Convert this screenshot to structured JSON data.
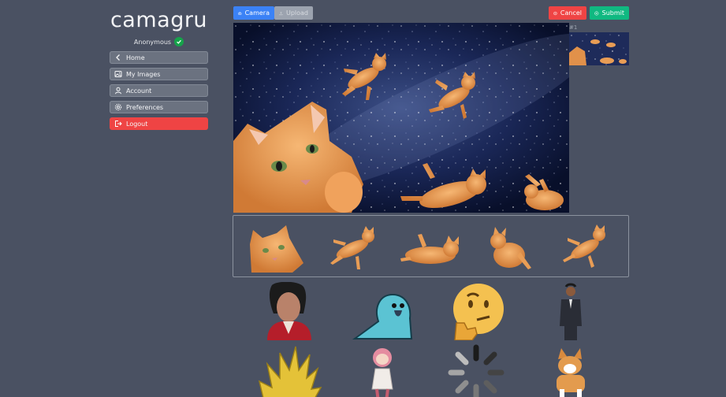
{
  "sidebar": {
    "brand": "camagru",
    "username": "Anonymous",
    "items": [
      {
        "label": "Home",
        "icon": "chevron-left-icon"
      },
      {
        "label": "My Images",
        "icon": "image-icon"
      },
      {
        "label": "Account",
        "icon": "user-icon"
      },
      {
        "label": "Preferences",
        "icon": "gear-icon"
      },
      {
        "label": "Logout",
        "icon": "logout-icon"
      }
    ]
  },
  "toolbar": {
    "camera_label": "Camera",
    "upload_label": "Upload",
    "cancel_label": "Cancel",
    "submit_label": "Submit"
  },
  "thumbnails": [
    {
      "label": "#1"
    }
  ],
  "colors": {
    "background": "#4a5162",
    "primary": "#3b82f6",
    "danger": "#ef4444",
    "success": "#10b981",
    "disabled": "#9ca3af"
  },
  "stickers_selected": [
    "cat-face",
    "flying-cat",
    "lying-cat",
    "sitting-cat",
    "flying-cat-2"
  ],
  "gallery": [
    "singer-portrait",
    "blue-parrot",
    "thinking-emoji",
    "man-in-suit",
    "spiky-yellow-hair",
    "pink-hair-girl",
    "loading-spinner",
    "corgi"
  ]
}
